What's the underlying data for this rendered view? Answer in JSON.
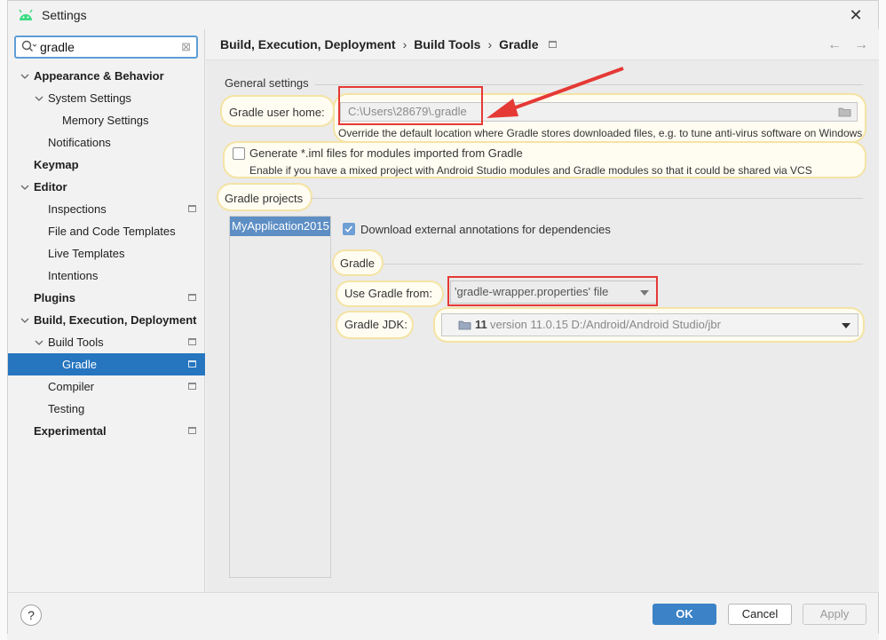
{
  "window": {
    "title": "Settings"
  },
  "search": {
    "value": "gradle"
  },
  "sidebar": {
    "items": [
      {
        "label": "Appearance & Behavior"
      },
      {
        "label": "System Settings"
      },
      {
        "label": "Memory Settings"
      },
      {
        "label": "Notifications"
      },
      {
        "label": "Keymap"
      },
      {
        "label": "Editor"
      },
      {
        "label": "Inspections"
      },
      {
        "label": "File and Code Templates"
      },
      {
        "label": "Live Templates"
      },
      {
        "label": "Intentions"
      },
      {
        "label": "Plugins"
      },
      {
        "label": "Build, Execution, Deployment"
      },
      {
        "label": "Build Tools"
      },
      {
        "label": "Gradle"
      },
      {
        "label": "Compiler"
      },
      {
        "label": "Testing"
      },
      {
        "label": "Experimental"
      }
    ],
    "selected": "Gradle"
  },
  "breadcrumb": {
    "items": [
      "Build, Execution, Deployment",
      "Build Tools",
      "Gradle"
    ],
    "separator": "›"
  },
  "nav": {
    "back": "←",
    "forward": "→"
  },
  "general": {
    "section_label": "General settings",
    "gradle_home_label": "Gradle user home:",
    "gradle_home_placeholder": "C:\\Users\\28679\\.gradle",
    "gradle_home_hint": "Override the default location where Gradle stores downloaded files, e.g. to tune anti-virus software on Windows",
    "iml_label": "Generate *.iml files for modules imported from Gradle",
    "iml_checked": false,
    "iml_hint": "Enable if you have a mixed project with Android Studio modules and Gradle modules so that it could be shared via VCS"
  },
  "projects": {
    "section_label": "Gradle projects",
    "list": [
      "MyApplication2015"
    ],
    "download_annotations_label": "Download external annotations for dependencies",
    "download_annotations_checked": true,
    "gradle_section_label": "Gradle",
    "use_gradle_from_label": "Use Gradle from:",
    "use_gradle_from_value": "'gradle-wrapper.properties' file",
    "gradle_jdk_label": "Gradle JDK:",
    "gradle_jdk_version": "11",
    "gradle_jdk_detail": "version 11.0.15 D:/Android/Android Studio/jbr"
  },
  "footer": {
    "help": "?",
    "ok": "OK",
    "cancel": "Cancel",
    "apply": "Apply"
  },
  "colors": {
    "selection": "#2675bf",
    "annotation_red": "#e53935",
    "primary_button": "#3b82c6"
  }
}
